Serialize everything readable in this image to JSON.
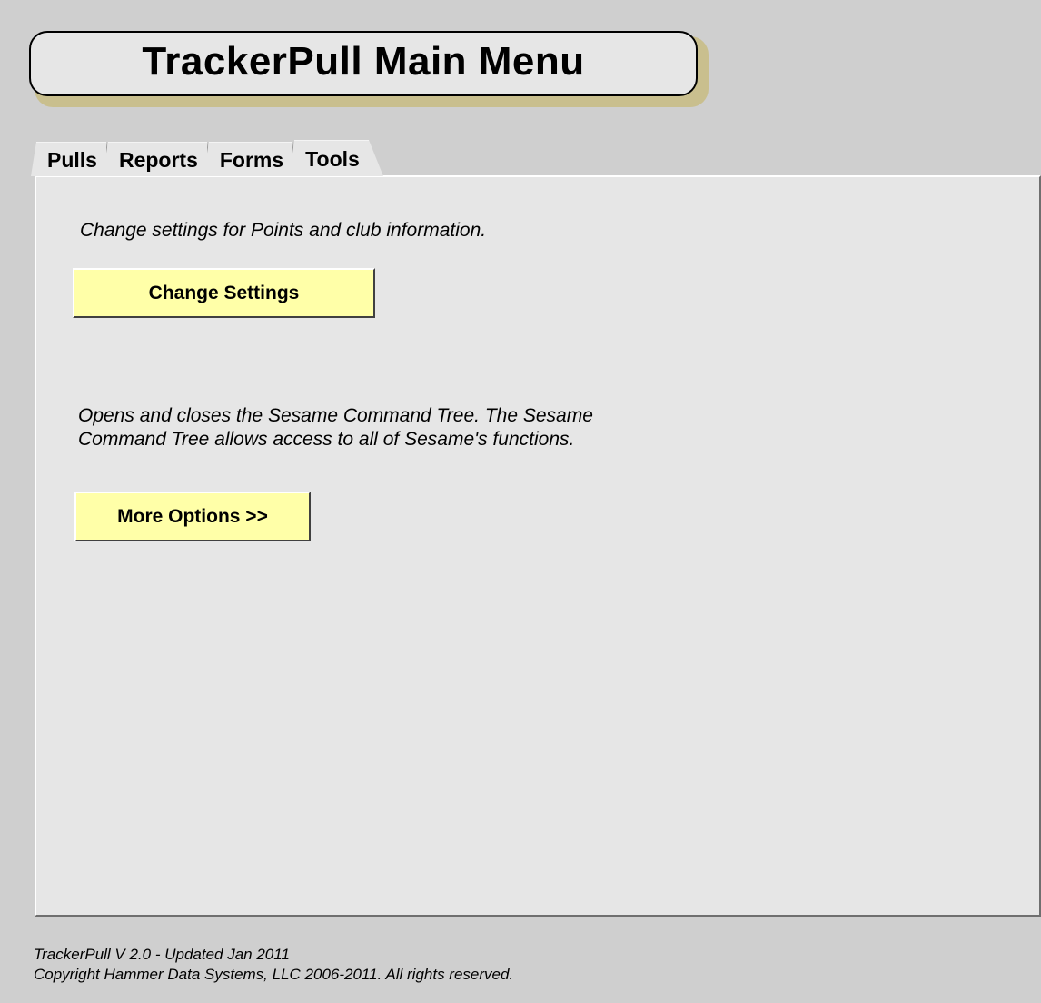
{
  "app": {
    "title": "TrackerPull Main Menu"
  },
  "tabs": [
    {
      "label": "Pulls",
      "active": false
    },
    {
      "label": "Reports",
      "active": false
    },
    {
      "label": "Forms",
      "active": false
    },
    {
      "label": "Tools",
      "active": true
    }
  ],
  "tools_panel": {
    "settings_description": "Change settings for Points and club information.",
    "settings_button_label": "Change Settings",
    "command_tree_description_line1": "Opens and closes the Sesame Command Tree. The Sesame",
    "command_tree_description_line2": "Command Tree allows access to all of Sesame's functions.",
    "more_options_button_label": "More Options >>"
  },
  "footer": {
    "version": "TrackerPull V 2.0 - Updated Jan 2011",
    "copyright": "Copyright Hammer Data Systems, LLC 2006-2011. All rights reserved."
  },
  "colors": {
    "background": "#cfcfcf",
    "panel": "#e6e6e6",
    "button": "#ffffa8",
    "title_shadow": "#c9bf8e"
  }
}
